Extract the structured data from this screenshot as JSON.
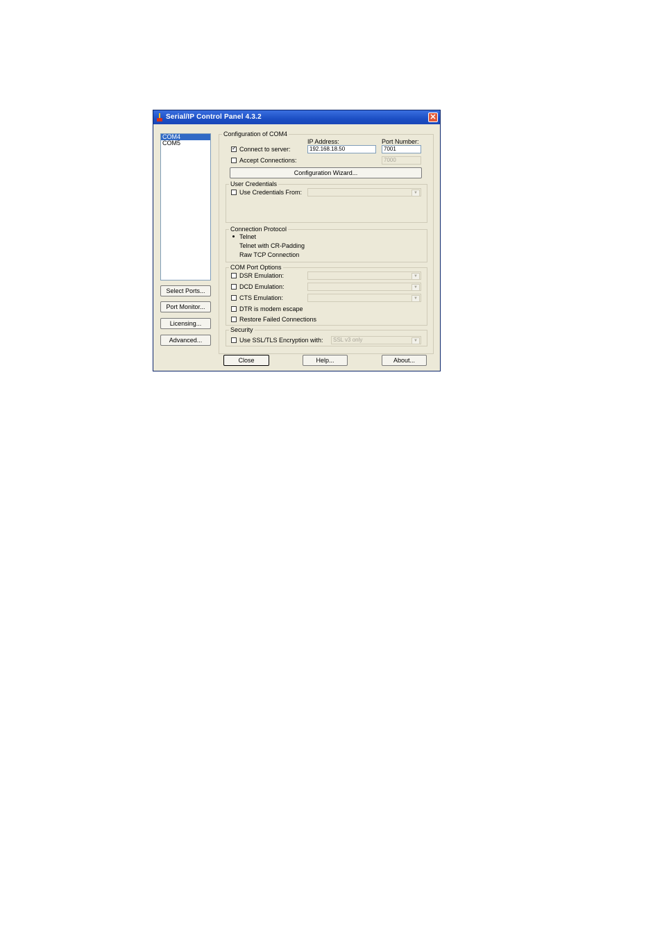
{
  "window": {
    "title": "Serial/IP Control Panel 4.3.2"
  },
  "com_ports": [
    "COM4",
    "COM5"
  ],
  "side_buttons": {
    "select_ports": "Select Ports...",
    "port_monitor": "Port Monitor...",
    "licensing": "Licensing...",
    "advanced": "Advanced..."
  },
  "config": {
    "group_label": "Configuration of COM4",
    "ip_address_label": "IP Address:",
    "port_number_label": "Port Number:",
    "connect_to_server": {
      "label": "Connect to server:",
      "checked": true,
      "ip": "192.168.18.50",
      "port": "7001"
    },
    "accept_connections": {
      "label": "Accept Connections:",
      "checked": false,
      "port": "7000"
    },
    "wizard_button": "Configuration Wizard..."
  },
  "credentials": {
    "group_label": "User Credentials",
    "use_credentials_label": "Use Credentials From:",
    "checked": false,
    "selected": ""
  },
  "protocol": {
    "group_label": "Connection Protocol",
    "options": [
      "Telnet",
      "Telnet with CR-Padding",
      "Raw TCP Connection"
    ],
    "selected": "Telnet"
  },
  "port_options": {
    "group_label": "COM Port Options",
    "dsr": "DSR Emulation:",
    "dcd": "DCD Emulation:",
    "cts": "CTS Emulation:",
    "dtr": "DTR is modem escape",
    "restore": "Restore Failed Connections"
  },
  "security": {
    "group_label": "Security",
    "ssl_label": "Use SSL/TLS Encryption with:",
    "ssl_value": "SSL v3 only"
  },
  "bottom_buttons": {
    "close": "Close",
    "help": "Help...",
    "about": "About..."
  }
}
